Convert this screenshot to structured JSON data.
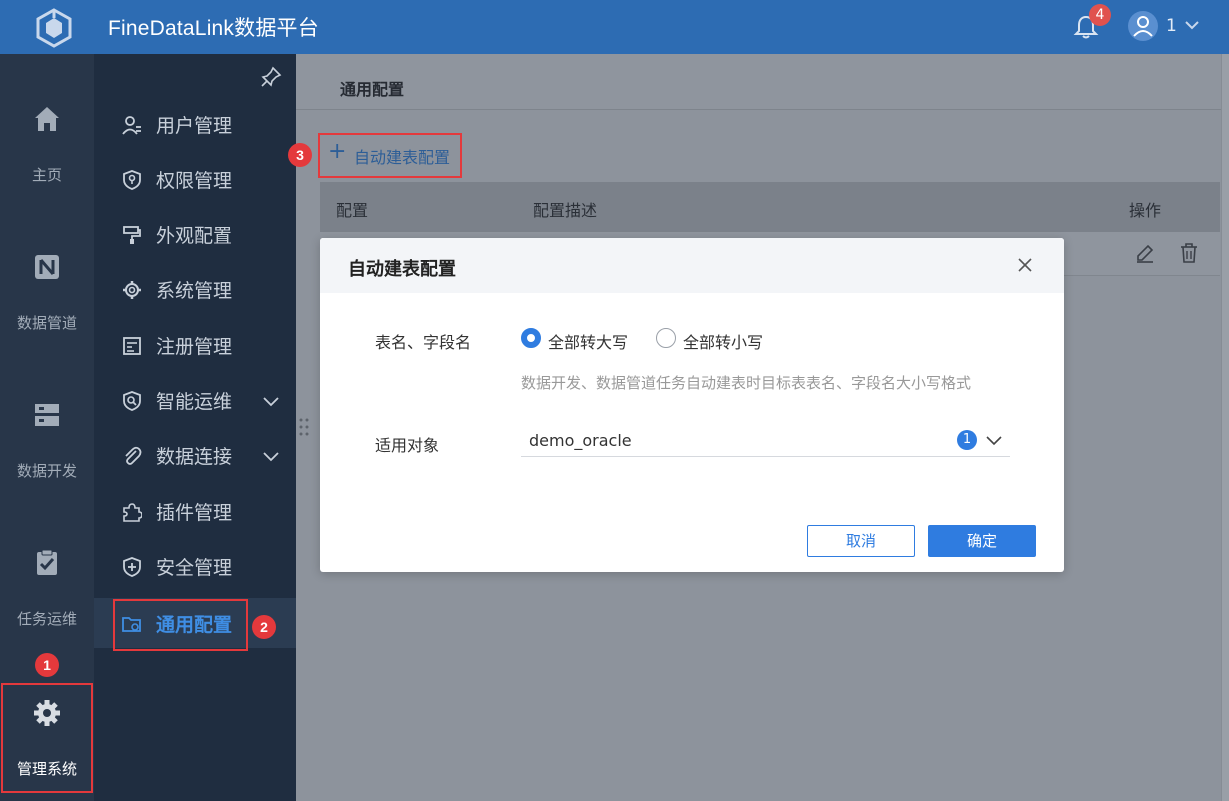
{
  "app": {
    "title": "FineDataLink数据平台",
    "notification_count": "4",
    "user_name": "1"
  },
  "iconnav": {
    "items": [
      {
        "label": "主页",
        "icon": "home-icon"
      },
      {
        "label": "数据管道",
        "icon": "data-pipeline-icon"
      },
      {
        "label": "数据开发",
        "icon": "data-development-icon"
      },
      {
        "label": "任务运维",
        "icon": "task-ops-icon"
      },
      {
        "label": "管理系统",
        "icon": "gear-icon"
      }
    ]
  },
  "submenu": {
    "items": [
      {
        "label": "用户管理",
        "icon": "user-icon"
      },
      {
        "label": "权限管理",
        "icon": "permission-icon"
      },
      {
        "label": "外观配置",
        "icon": "paint-roller-icon"
      },
      {
        "label": "系统管理",
        "icon": "gear-icon"
      },
      {
        "label": "注册管理",
        "icon": "register-icon"
      },
      {
        "label": "智能运维",
        "icon": "smart-ops-icon"
      },
      {
        "label": "数据连接",
        "icon": "paperclip-icon"
      },
      {
        "label": "插件管理",
        "icon": "puzzle-icon"
      },
      {
        "label": "安全管理",
        "icon": "shield-plus-icon"
      },
      {
        "label": "通用配置",
        "icon": "folder-gear-icon"
      }
    ]
  },
  "main": {
    "page_title": "通用配置",
    "add_button": "自动建表配置",
    "table": {
      "headers": [
        "配置",
        "配置描述",
        "操作"
      ]
    }
  },
  "modal": {
    "title": "自动建表配置",
    "field1_label": "表名、字段名",
    "radio_upper": "全部转大写",
    "radio_lower": "全部转小写",
    "selected": "全部转大写",
    "hint": "数据开发、数据管道任务自动建表时目标表表名、字段名大小写格式",
    "field2_label": "适用对象",
    "select_value": "demo_oracle",
    "select_count": "1",
    "cancel": "取消",
    "ok": "确定"
  },
  "annotations": [
    "1",
    "2",
    "3"
  ],
  "colors": {
    "topbar": "#2d6cb3",
    "accent": "#2f7ce0",
    "annotation": "#e4393c"
  }
}
